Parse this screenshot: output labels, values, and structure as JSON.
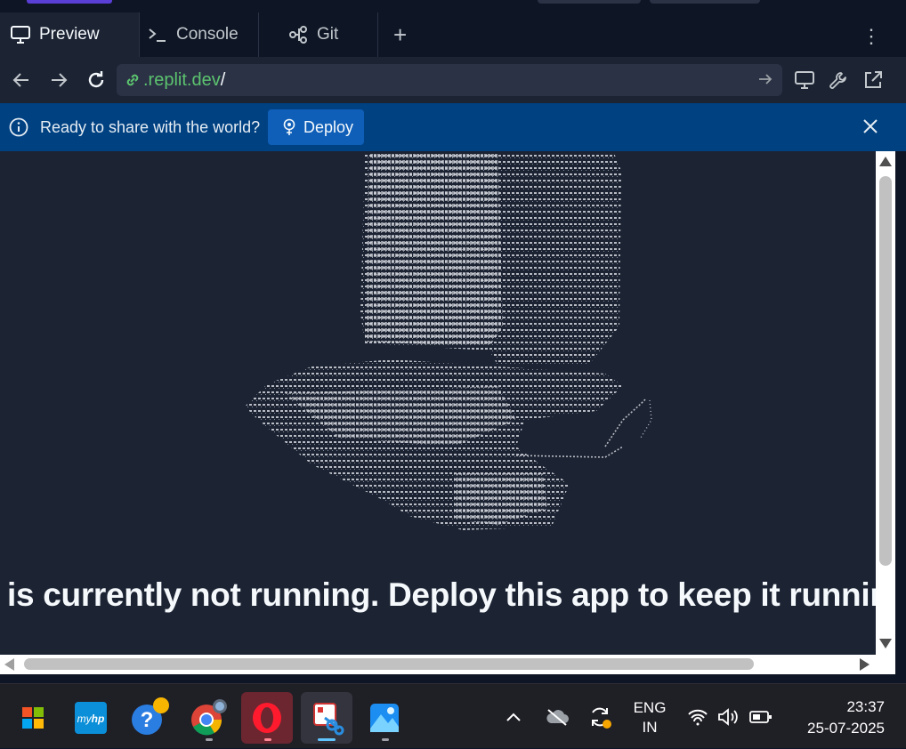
{
  "tabs": {
    "preview": "Preview",
    "console": "Console",
    "git": "Git",
    "add": "+",
    "more": "⋮"
  },
  "urlbar": {
    "host": ".replit.dev",
    "path": "/"
  },
  "banner": {
    "message": "Ready to share with the world?",
    "deploy_label": "Deploy"
  },
  "viewport": {
    "notice": "is currently not running. Deploy this app to keep it running ex"
  },
  "taskbar": {
    "apps": [
      "Start",
      "myHP",
      "Get Help",
      "Google Chrome",
      "Opera",
      "Snipping Tool",
      "Photos"
    ],
    "language_line1": "ENG",
    "language_line2": "IN",
    "time": "23:37",
    "date": "25-07-2025"
  },
  "colors": {
    "accent_green": "#5cc36f",
    "banner_blue": "#004182",
    "deploy_blue": "#0f5fb8",
    "opera_red": "#ff1b2d"
  }
}
